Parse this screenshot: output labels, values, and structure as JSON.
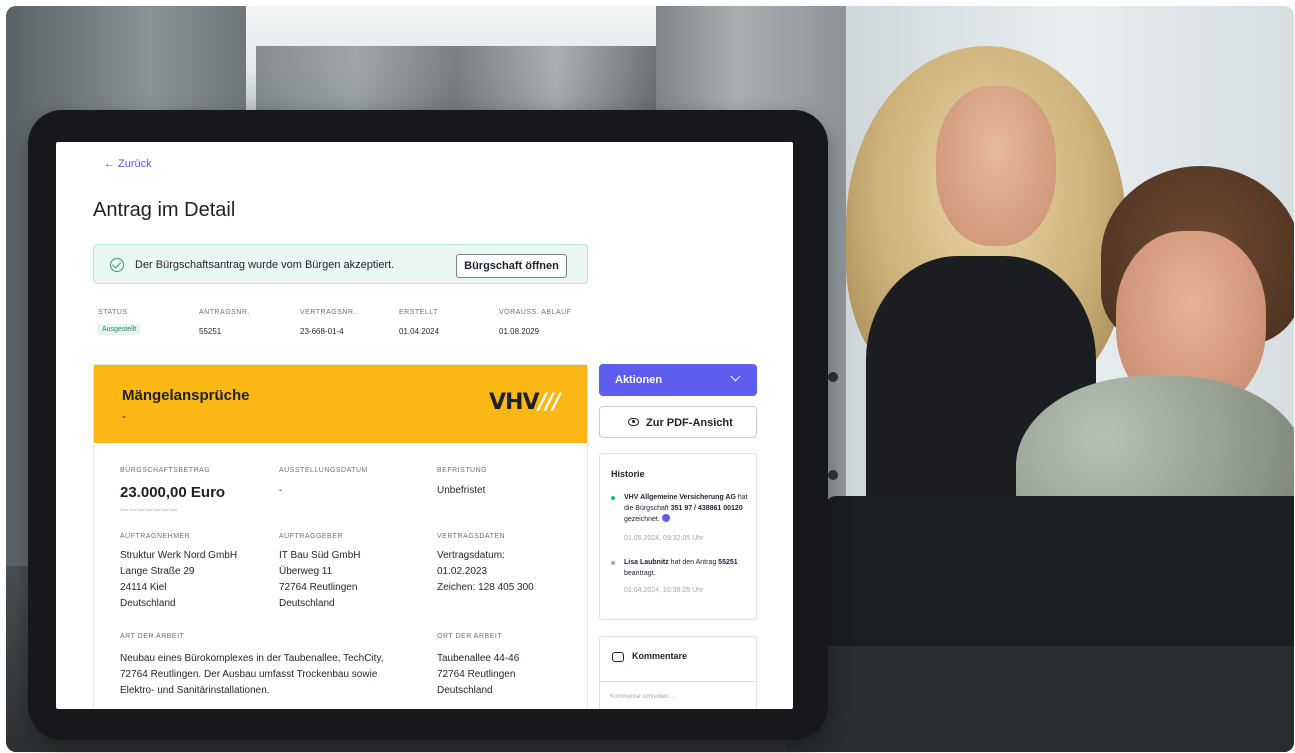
{
  "back_label": "← Zurück",
  "page_title": "Antrag im Detail",
  "alert": {
    "message": "Der Bürgschaftsantrag wurde vom Bürgen akzeptiert.",
    "button_label": "Bürgschaft öffnen"
  },
  "meta": {
    "status_label": "STATUS",
    "status_value": "Ausgestellt",
    "antragsnr_label": "ANTRAGSNR.",
    "antragsnr_value": "55251",
    "vertragsnr_label": "VERTRAGSNR.",
    "vertragsnr_value": "23-668-01-4",
    "erstellt_label": "ERSTELLT",
    "erstellt_value": "01.04.2024",
    "ablauf_label": "VORAUSS. ABLAUF",
    "ablauf_value": "01.08.2029"
  },
  "card": {
    "title": "Mängelansprüche",
    "subtitle": "-",
    "logo_text": "VHV",
    "logo_slashes": "///",
    "betrag_label": "BÜRGSCHAFTSBETRAG",
    "betrag_value": "23.000,00 Euro",
    "betrag_words": "Zwei Drei Null Null Null Null Null",
    "ausstellung_label": "AUSSTELLUNGSDATUM",
    "ausstellung_value": "-",
    "befristung_label": "BEFRISTUNG",
    "befristung_value": "Unbefristet",
    "auftragnehmer_label": "AUFTRAGNEHMER",
    "auftragnehmer_lines": [
      "Struktur Werk Nord GmbH",
      "Lange Straße 29",
      "24114 Kiel",
      "Deutschland"
    ],
    "auftraggeber_label": "AUFTRAGGEBER",
    "auftraggeber_lines": [
      "IT Bau Süd GmbH",
      "Überweg 11",
      "72764 Reutlingen",
      "Deutschland"
    ],
    "vertragsdaten_label": "VERTRAGSDATEN",
    "vertragsdaten_lines": [
      "Vertragsdatum:",
      "01.02.2023",
      "Zeichen: 128 405 300"
    ],
    "art_label": "ART DER ARBEIT",
    "art_lines": [
      "Neubau eines Bürokomplexes in der Taubenallee, TechCity,",
      "72764 Reutlingen. Der Ausbau umfasst Trockenbau sowie",
      "Elektro- und Sanitärinstallationen."
    ],
    "ort_label": "ORT DER ARBEIT",
    "ort_lines": [
      "Taubenallee 44-46",
      "72764 Reutlingen",
      "Deutschland"
    ]
  },
  "side": {
    "actions_label": "Aktionen",
    "pdf_label": "Zur PDF-Ansicht",
    "history_title": "Historie",
    "history": [
      {
        "text_strong": "VHV Allgemeine Versicherung AG",
        "text_rest": " hat die Bürgschaft ",
        "ref": "351 97 / 438861 00120",
        "text_end": " gezeichnet.",
        "timestamp": "01.05.2024, 09:32:05 Uhr",
        "dot_color": "#2bb57e"
      },
      {
        "text_strong": "Lisa Laubnitz",
        "text_rest": " hat den Antrag ",
        "ref": "55251",
        "text_end": " beantragt.",
        "timestamp": "01.04.2024, 10:38:25 Uhr",
        "dot_color": "#a6a8b2"
      }
    ],
    "comments_title": "Kommentare",
    "comment_placeholder": "Kommentar schreiben ..."
  },
  "colors": {
    "accent": "#5d5ef0",
    "card_header": "#fbb713",
    "success": "#2f9a72"
  },
  "icons": [
    "arrow-left-icon",
    "check-circle-icon",
    "chevron-down-icon",
    "eye-icon",
    "comment-icon",
    "verified-badge-icon"
  ]
}
